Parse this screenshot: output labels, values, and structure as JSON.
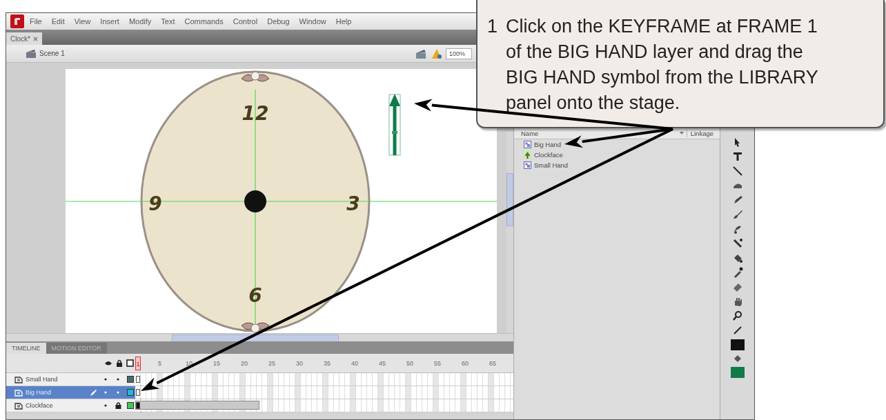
{
  "menu": [
    "File",
    "Edit",
    "View",
    "Insert",
    "Modify",
    "Text",
    "Commands",
    "Control",
    "Debug",
    "Window",
    "Help"
  ],
  "document_tabs": [
    {
      "label": "Clock*",
      "selected": true
    }
  ],
  "scene": {
    "label": "Scene 1",
    "zoom": "100%"
  },
  "stage": {
    "clock_numbers": [
      "12",
      "3",
      "6",
      "9"
    ]
  },
  "library": {
    "columns": [
      "Name",
      "Linkage"
    ],
    "items": [
      {
        "name": "Big Hand",
        "kind": "symbol"
      },
      {
        "name": "Clockface",
        "kind": "bitmap"
      },
      {
        "name": "Small Hand",
        "kind": "symbol"
      }
    ]
  },
  "timeline": {
    "tabs": [
      {
        "label": "TIMELINE",
        "selected": true
      },
      {
        "label": "MOTION EDITOR",
        "selected": false
      }
    ],
    "frame_numbers": [
      "1",
      "5",
      "10",
      "15",
      "20",
      "25",
      "30",
      "35",
      "40",
      "45",
      "50",
      "55",
      "60",
      "65"
    ],
    "layers": [
      {
        "name": "Small Hand",
        "selected": false,
        "locked": false,
        "color": "#4d6a6a",
        "kind": "empty"
      },
      {
        "name": "Big Hand",
        "selected": true,
        "locked": false,
        "color": "#22b8d8",
        "kind": "empty"
      },
      {
        "name": "Clockface",
        "selected": false,
        "locked": true,
        "color": "#3cc85a",
        "kind": "span"
      }
    ]
  },
  "callout": {
    "step": "1",
    "text": "Click on the KEYFRAME at FRAME 1\nof the BIG HAND layer and drag the\nBIG HAND symbol from the LIBRARY\npanel onto the stage."
  }
}
